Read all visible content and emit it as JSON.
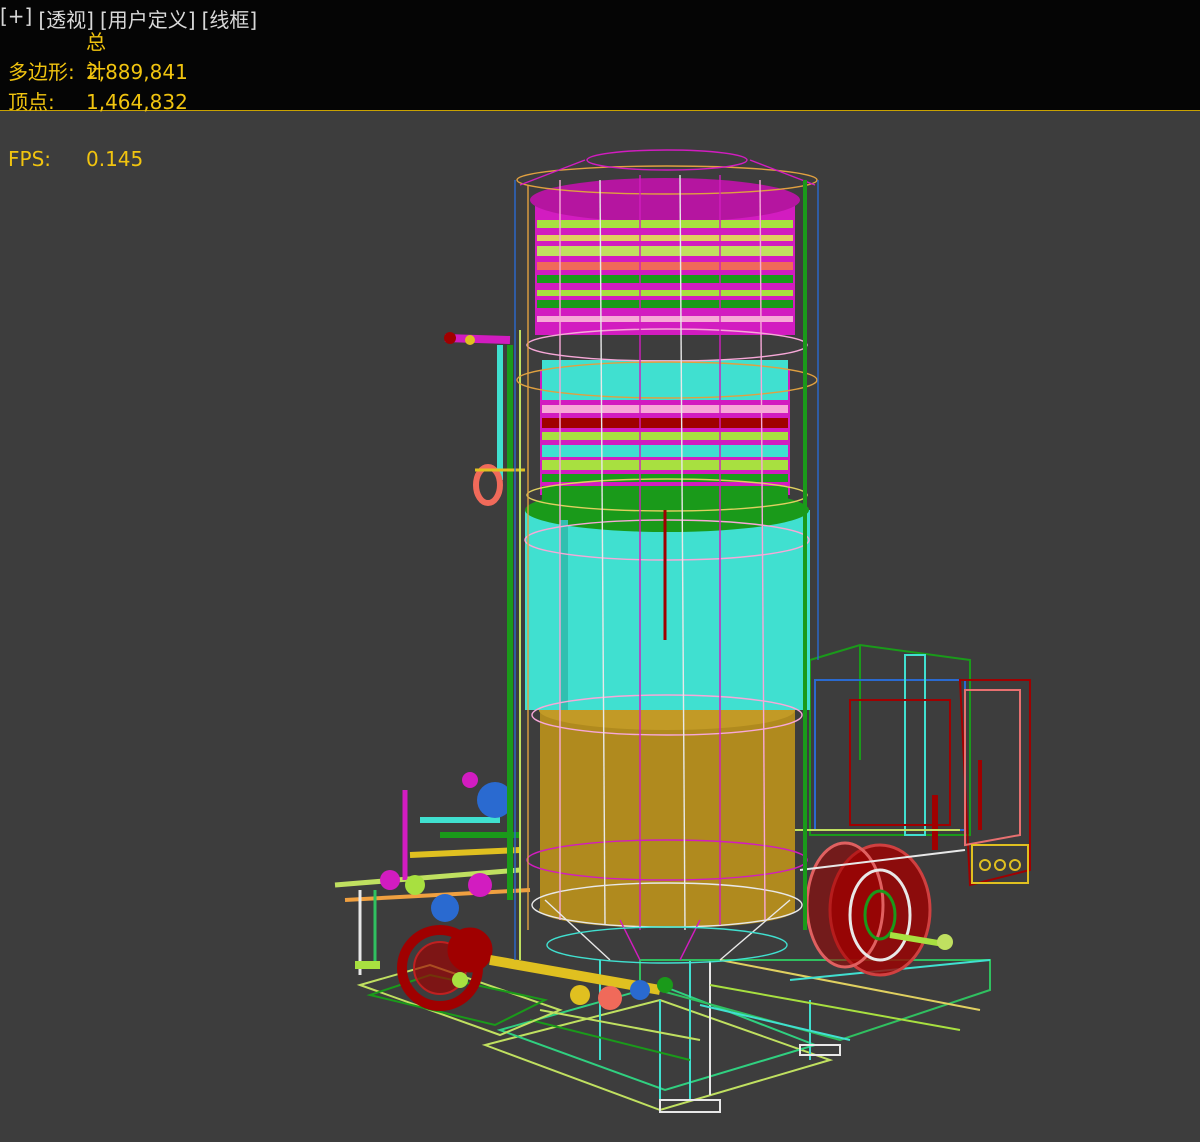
{
  "viewport_menu": {
    "plus": "[+]",
    "perspective": "[透视]",
    "user_defined": "[用户定义]",
    "wireframe": "[线框]"
  },
  "stats": {
    "header": "总计",
    "polygons_label": "多边形:",
    "polygons_value": "2,889,841",
    "vertices_label": "顶点:",
    "vertices_value": "1,464,832"
  },
  "fps": {
    "label": "FPS:",
    "value": "0.145"
  },
  "colors": {
    "background": "#3d3d3d",
    "topbar": "#050505",
    "stat_text": "#f1c40f",
    "menu_text": "#d9d9d9",
    "magenta": "#d21cc0",
    "cyan": "#40e0d0",
    "ochre": "#b08a1e",
    "green": "#1a9a1a",
    "red": "#a00000",
    "blue": "#2a6ad0",
    "lime": "#a8e040",
    "salmon": "#f06a5a"
  }
}
